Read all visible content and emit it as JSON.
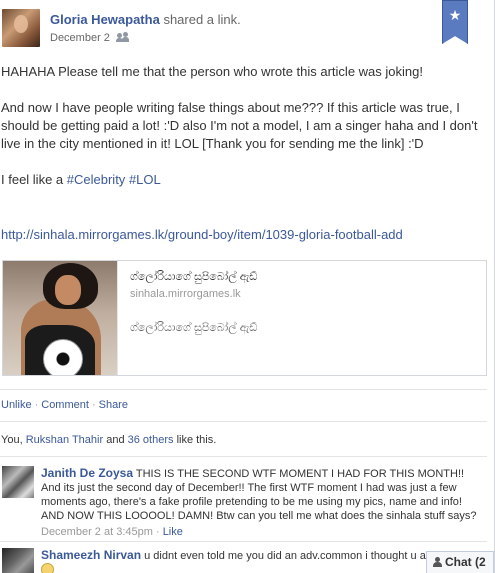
{
  "post": {
    "author": "Gloria Hewapatha",
    "action": "shared a link.",
    "date": "December 2",
    "message_p1": "HAHAHA Please tell me that the person who wrote this article was joking!",
    "message_p2": "And now I have people writing false things about me??? If this article was true, I should be getting paid a lot! :'D also I'm not a model, I am a singer haha and I don't live in the city mentioned in it! LOL [Thank you for sending me the link] :'D",
    "message_p3_prefix": "I feel like a",
    "tags": [
      "#Celebrity",
      "#LOL"
    ],
    "url": "http://sinhala.mirrorgames.lk/ground-boy/item/1039-gloria-football-add"
  },
  "share": {
    "title": "ග්ලෝරියාගේ සුපිබෝල් ඇඩ්",
    "domain": "sinhala.mirrorgames.lk",
    "description": "ග්ලෝරියාගේ සුපිබෝල් ඇඩ්"
  },
  "actions": {
    "unlike": "Unlike",
    "comment": "Comment",
    "share": "Share",
    "separator": "·"
  },
  "likes": {
    "prefix": "You,",
    "person": "Rukshan Thahir",
    "middle": "and",
    "others": "36 others",
    "suffix": "like this."
  },
  "comments": [
    {
      "author": "Janith De Zoysa",
      "text": "THIS IS THE SECOND WTF MOMENT I HAD FOR THIS MONTH!! And its just the second day of December!! The first WTF moment I had was just a few moments ago, there's a fake profile pretending to be me using my pics, name and info! AND NOW THIS LOOOOL! DAMN! Btw can you tell me what does the sinhala stuff says?",
      "time": "December 2 at 3:45pm",
      "like": "Like"
    },
    {
      "author": "Shameezh Nirvan",
      "text": "u didnt even told me you did an adv.common i thought u are"
    }
  ],
  "chat": {
    "label": "Chat (2"
  },
  "icons": {
    "ribbon": "star-icon",
    "audience": "friends-icon",
    "chat": "person-icon"
  },
  "colors": {
    "link": "#3b5998",
    "ribbon": "#5b7bc0"
  }
}
